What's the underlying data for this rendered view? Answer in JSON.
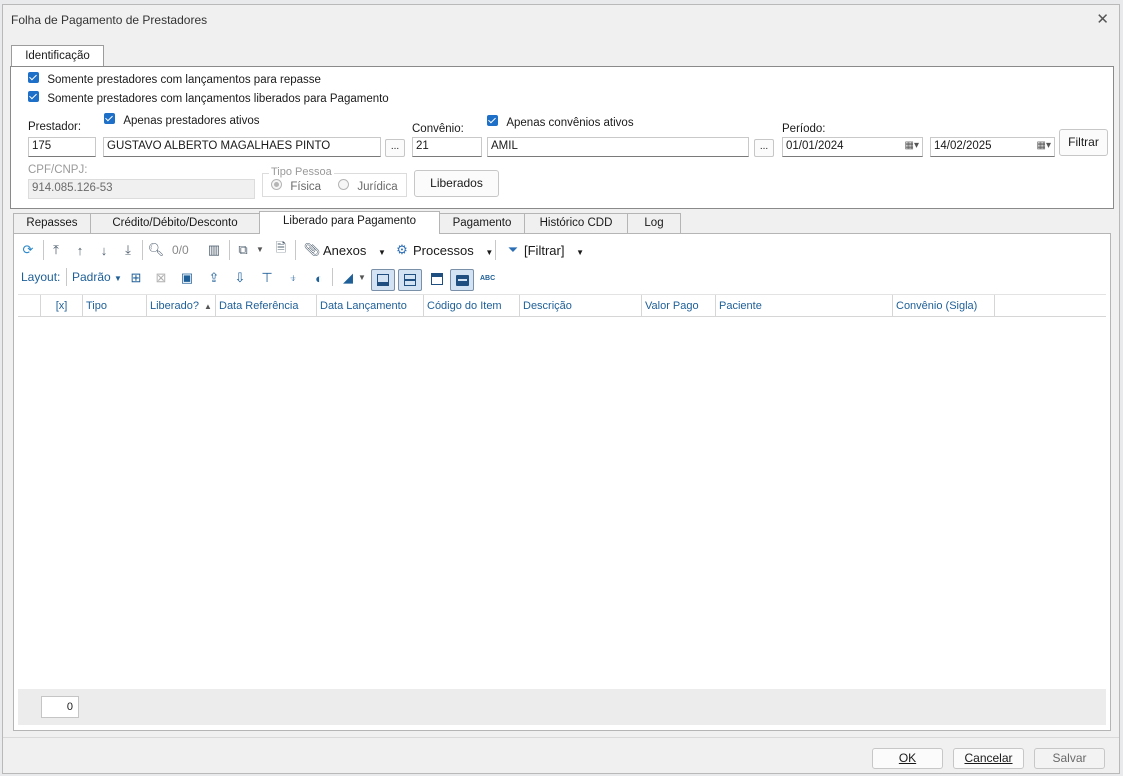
{
  "window": {
    "title": "Folha de Pagamento de Prestadores"
  },
  "top_tab": {
    "label": "Identificação"
  },
  "filters": {
    "only_repasse": "Somente prestadores com lançamentos para repasse",
    "only_liberados": "Somente prestadores com lançamentos liberados para Pagamento",
    "prestador_label": "Prestador:",
    "prestador_code": "175",
    "prestador_name": "GUSTAVO ALBERTO MAGALHAES PINTO",
    "apenas_prestadores": "Apenas prestadores ativos",
    "convenio_label": "Convênio:",
    "convenio_code": "21",
    "convenio_name": "AMIL",
    "apenas_convenios": "Apenas convênios ativos",
    "periodo_label": "Período:",
    "periodo_start": "01/01/2024",
    "periodo_end": "14/02/2025",
    "filtrar_button": "Filtrar",
    "cpf_label": "CPF/CNPJ:",
    "cpf_value": "914.085.126-53",
    "tipo_pessoa_label": "Tipo Pessoa",
    "fisica": "Física",
    "juridica": "Jurídica",
    "liberados_button": "Liberados",
    "ellipsis": "..."
  },
  "tabs": [
    {
      "label": "Repasses"
    },
    {
      "label": "Crédito/Débito/Desconto"
    },
    {
      "label": "Liberado para Pagamento"
    },
    {
      "label": "Pagamento"
    },
    {
      "label": "Histórico CDD"
    },
    {
      "label": "Log"
    }
  ],
  "toolbar": {
    "counter": "0/0",
    "anexos": "Anexos",
    "processos": "Processos",
    "filtrar": "[Filtrar]"
  },
  "layout_bar": {
    "layout_label": "Layout:",
    "layout_value": "Padrão",
    "abc": "ABC"
  },
  "grid": {
    "columns": [
      "[x]",
      "Tipo",
      "Liberado?",
      "Data Referência",
      "Data Lançamento",
      "Código do Item",
      "Descrição",
      "Valor Pago",
      "Paciente",
      "Convênio (Sigla)"
    ],
    "rows": [],
    "footer_count": "0"
  },
  "buttons": {
    "ok": "OK",
    "cancelar": "Cancelar",
    "salvar": "Salvar"
  }
}
